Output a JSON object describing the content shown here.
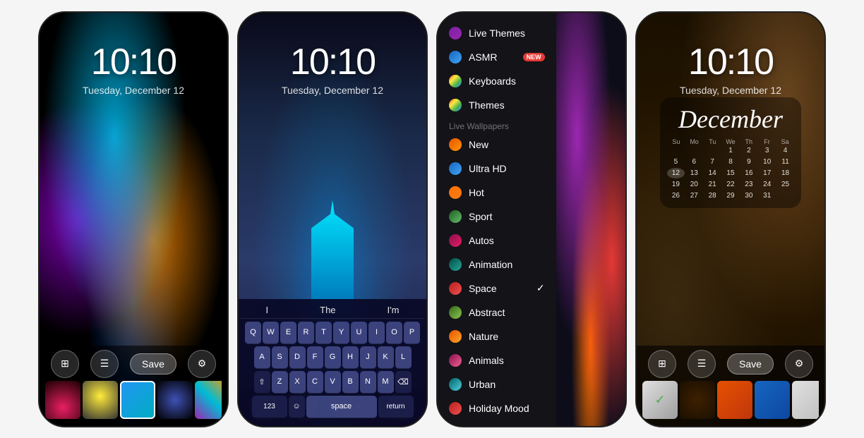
{
  "screens": [
    {
      "id": "screen1",
      "time": "10:10",
      "date": "Tuesday, December 12",
      "bottom_buttons": [
        "grid-icon",
        "list-icon",
        "save-label",
        "gear-icon"
      ],
      "save_label": "Save"
    },
    {
      "id": "screen2",
      "time": "10:10",
      "date": "Tuesday, December 12",
      "suggestions": [
        "I",
        "The",
        "I'm"
      ],
      "keyboard_rows": [
        [
          "Q",
          "W",
          "E",
          "R",
          "T",
          "Y",
          "U",
          "I",
          "O",
          "P"
        ],
        [
          "A",
          "S",
          "D",
          "F",
          "G",
          "H",
          "J",
          "K",
          "L"
        ],
        [
          "⇧",
          "Z",
          "X",
          "C",
          "V",
          "B",
          "N",
          "M",
          "⌫"
        ],
        [
          "123",
          "☺",
          "space",
          "return"
        ]
      ]
    },
    {
      "id": "screen3",
      "menu_items": [
        {
          "label": "Live Themes",
          "dot_class": "dot-purple",
          "badge": null,
          "checked": false
        },
        {
          "label": "ASMR",
          "dot_class": "dot-blue",
          "badge": "NEW",
          "checked": false
        },
        {
          "label": "Keyboards",
          "dot_class": "dot-rainbow",
          "badge": null,
          "checked": false
        },
        {
          "label": "Themes",
          "dot_class": "dot-rainbow",
          "badge": null,
          "checked": false
        }
      ],
      "section_label": "Live Wallpapers",
      "wallpaper_items": [
        {
          "label": "New",
          "dot_class": "dot-orange",
          "checked": false
        },
        {
          "label": "Ultra HD",
          "dot_class": "dot-blue",
          "checked": false
        },
        {
          "label": "Hot",
          "dot_class": "dot-fire",
          "checked": false
        },
        {
          "label": "Sport",
          "dot_class": "dot-green",
          "checked": false
        },
        {
          "label": "Autos",
          "dot_class": "dot-crimson",
          "checked": false
        },
        {
          "label": "Animation",
          "dot_class": "dot-teal",
          "checked": false
        },
        {
          "label": "Space",
          "dot_class": "dot-red",
          "checked": true
        },
        {
          "label": "Abstract",
          "dot_class": "dot-green2",
          "checked": false
        },
        {
          "label": "Nature",
          "dot_class": "dot-amber",
          "checked": false
        },
        {
          "label": "Animals",
          "dot_class": "dot-pink",
          "checked": false
        },
        {
          "label": "Urban",
          "dot_class": "dot-cyan",
          "checked": false
        },
        {
          "label": "Holiday Mood",
          "dot_class": "dot-red",
          "checked": false
        }
      ]
    },
    {
      "id": "screen4",
      "time": "10:10",
      "date": "Tuesday, December 12",
      "calendar_month": "December",
      "calendar_headers": [
        "Su",
        "Mo",
        "Tu",
        "We",
        "Th",
        "Fr",
        "Sa"
      ],
      "calendar_rows": [
        [
          "",
          "",
          "",
          "1",
          "2",
          "3",
          "4"
        ],
        [
          "5",
          "6",
          "7",
          "8",
          "9",
          "10",
          "11"
        ],
        [
          "12",
          "13",
          "14",
          "15",
          "16",
          "17",
          "18"
        ],
        [
          "19",
          "20",
          "21",
          "22",
          "23",
          "24",
          "25"
        ],
        [
          "26",
          "27",
          "28",
          "29",
          "30",
          "31",
          ""
        ]
      ],
      "save_label": "Save"
    }
  ]
}
